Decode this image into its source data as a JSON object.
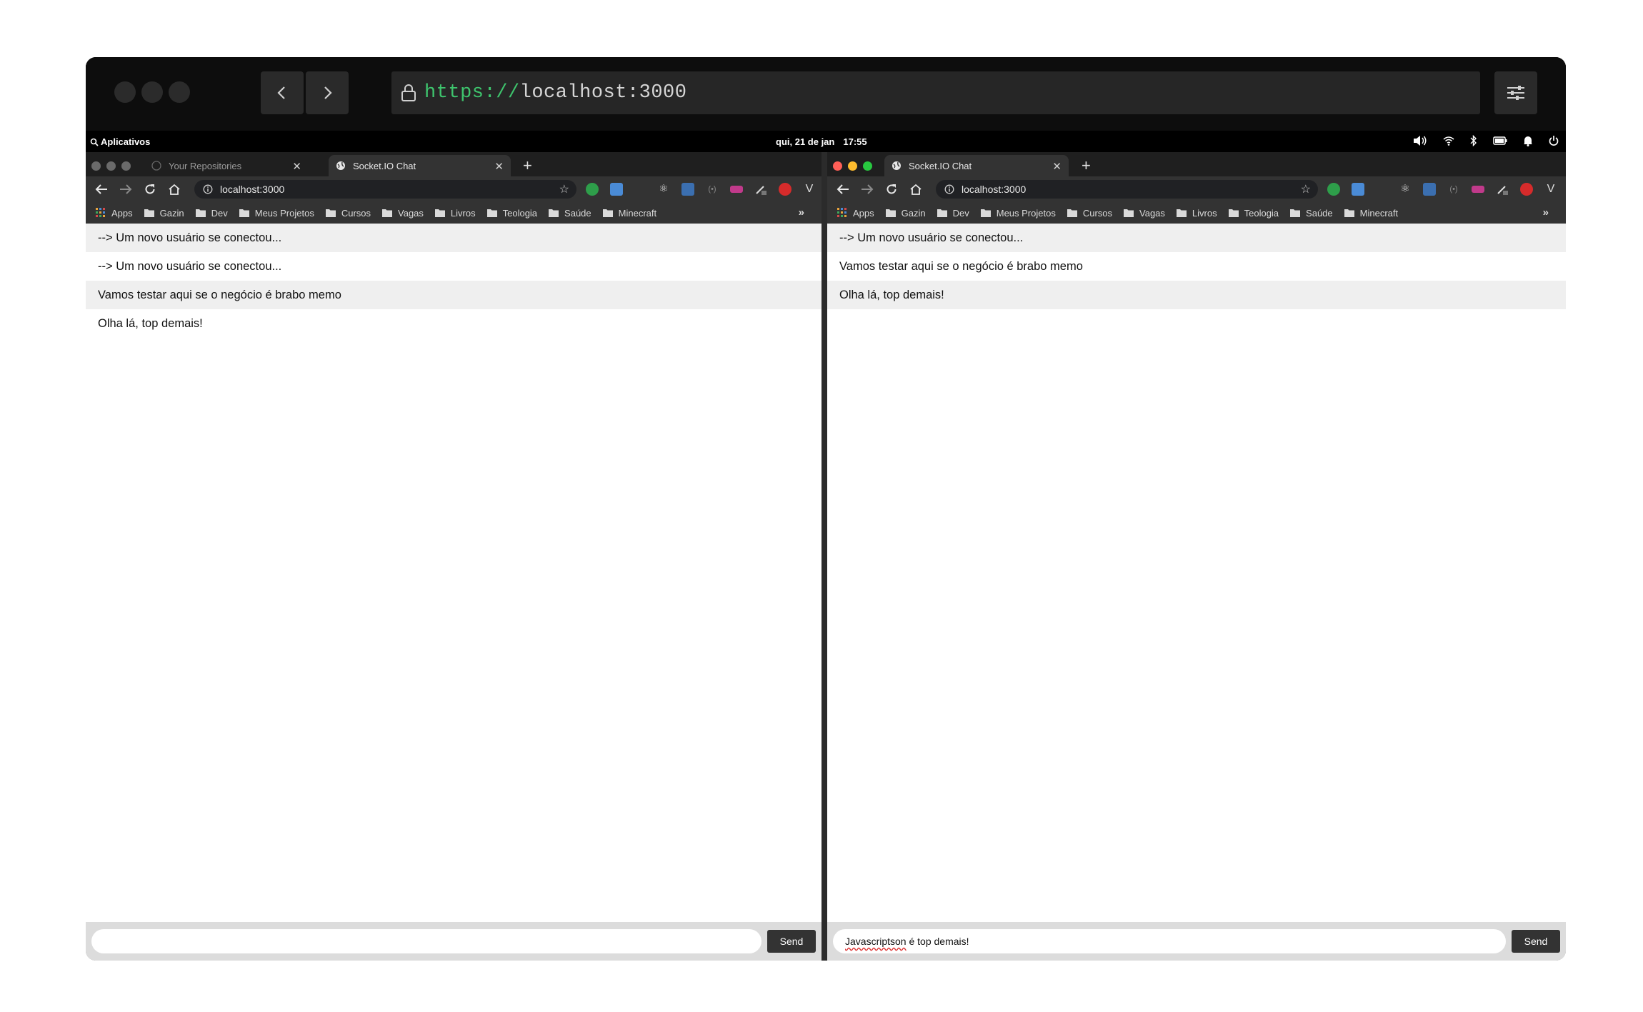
{
  "outer": {
    "url_scheme": "https://",
    "url_host": "localhost:3000"
  },
  "gnome": {
    "activities": "Aplicativos",
    "date": "qui, 21 de jan",
    "time": "17:55"
  },
  "left": {
    "tabs": [
      {
        "label": "Your Repositories",
        "icon": "github-icon",
        "active": false
      },
      {
        "label": "Socket.IO Chat",
        "icon": "globe-icon",
        "active": true
      }
    ],
    "omnibox": "localhost:3000",
    "messages": [
      "--> Um novo usuário se conectou...",
      "--> Um novo usuário se conectou...",
      "Vamos testar aqui se o negócio é brabo memo",
      "Olha lá, top demais!"
    ],
    "input_value": "",
    "send_label": "Send"
  },
  "right": {
    "tabs": [
      {
        "label": "Socket.IO Chat",
        "icon": "globe-icon",
        "active": true
      }
    ],
    "omnibox": "localhost:3000",
    "messages": [
      "--> Um novo usuário se conectou...",
      "Vamos testar aqui se o negócio é brabo memo",
      "Olha lá, top demais!"
    ],
    "input_word_misspelled": "Javascriptson",
    "input_rest": " é top demais!",
    "send_label": "Send"
  },
  "bookmarks": [
    "Apps",
    "Gazin",
    "Dev",
    "Meus Projetos",
    "Cursos",
    "Vagas",
    "Livros",
    "Teologia",
    "Saúde",
    "Minecraft"
  ],
  "colors": {
    "url_scheme": "#3ec46d",
    "close_dot": "#ff5f57",
    "min_dot": "#febc2e",
    "max_dot": "#28c840"
  }
}
